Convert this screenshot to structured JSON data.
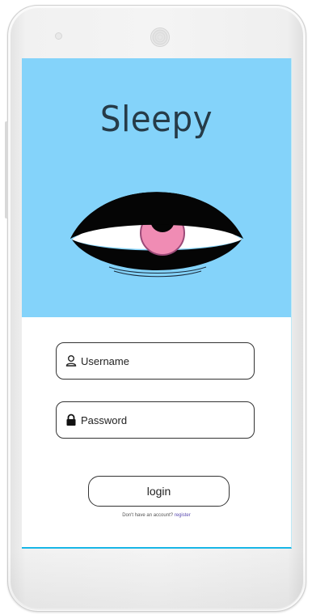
{
  "app": {
    "title": "Sleepy"
  },
  "form": {
    "username_placeholder": "Username",
    "password_placeholder": "Password",
    "login_label": "login"
  },
  "footer": {
    "prompt": "Don't have an account?",
    "register_link": "register"
  },
  "icons": {
    "username": "user-icon",
    "password": "lock-icon",
    "hero": "eye-illustration"
  },
  "colors": {
    "hero_background": "#84d3fa",
    "iris": "#f08cb4",
    "accent_line": "#19b6e6"
  }
}
